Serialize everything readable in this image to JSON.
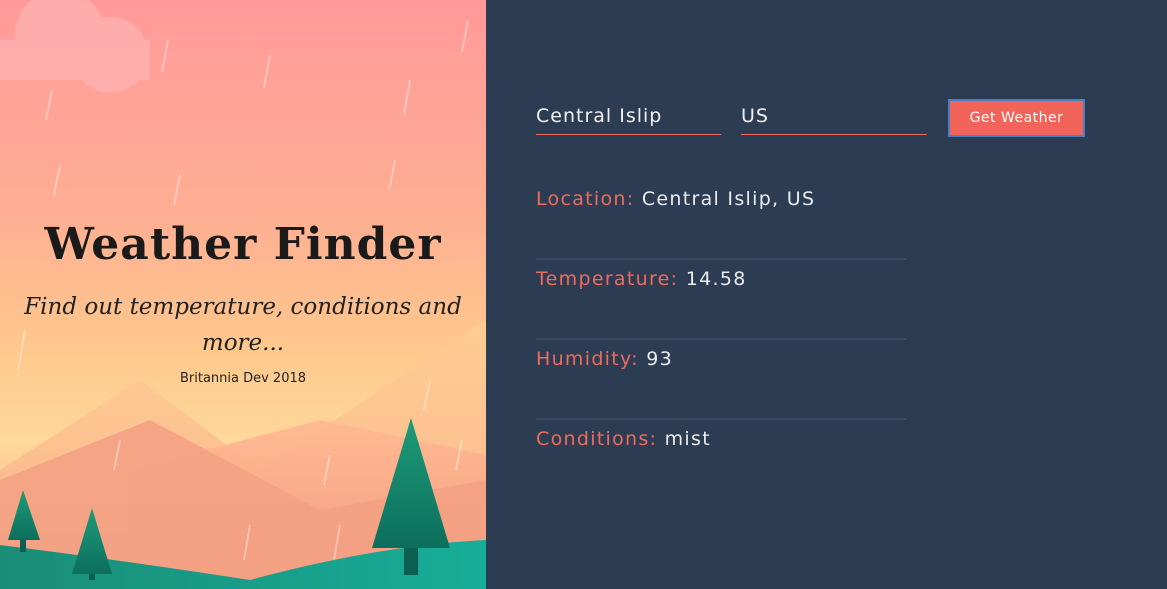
{
  "hero": {
    "title": "Weather Finder",
    "subtitle": "Find out temperature, conditions and more...",
    "credit": "Britannia Dev 2018"
  },
  "form": {
    "city_value": "Central Islip",
    "country_value": "US",
    "submit_label": "Get Weather"
  },
  "results": [
    {
      "label": "Location:",
      "value": "Central Islip, US"
    },
    {
      "label": "Temperature:",
      "value": "14.58"
    },
    {
      "label": "Humidity:",
      "value": "93"
    },
    {
      "label": "Conditions:",
      "value": "mist"
    }
  ],
  "colors": {
    "accent": "#f06a5d",
    "panel_bg": "#2c3c52",
    "divider": "#374a61"
  }
}
